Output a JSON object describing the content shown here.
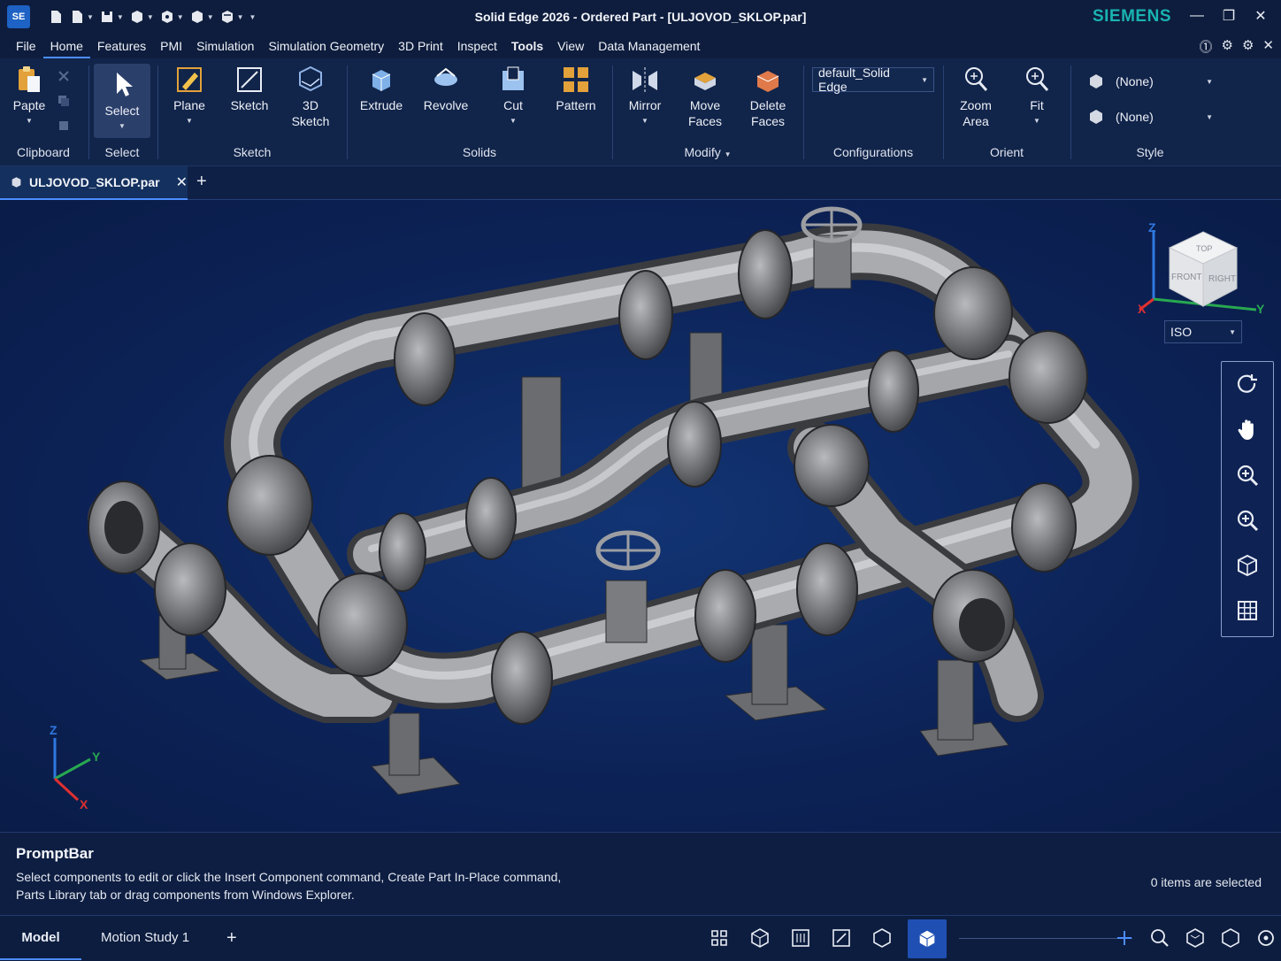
{
  "titlebar": {
    "app_badge": "SE",
    "title": "Solid Edge 2026 - Ordered Part - [ULJOVOD_SKLOP.par]",
    "brand": "SIEMENS"
  },
  "menu": {
    "tabs": [
      "File",
      "Home",
      "Features",
      "PMI",
      "Simulation",
      "Simulation Geometry",
      "3D Print",
      "Inspect",
      "Tools",
      "View",
      "Data Management"
    ],
    "active": "Home"
  },
  "ribbon": {
    "clipboard": {
      "paste": "Papte",
      "label": "Clipboard"
    },
    "select": {
      "button": "Select",
      "label": "Select"
    },
    "sketch": {
      "plane": "Plane",
      "sketch": "Sketch",
      "sketch3d_line1": "3D",
      "sketch3d_line2": "Sketch",
      "label": "Sketch"
    },
    "solids": {
      "extrude": "Extrude",
      "revolve": "Revolve",
      "cut": "Cut",
      "pattern": "Pattern",
      "label": "Solids"
    },
    "modify": {
      "mirror": "Mirror",
      "move_line1": "Move",
      "move_line2": "Faces",
      "delete_line1": "Delete",
      "delete_line2": "Faces",
      "label": "Modify"
    },
    "configurations": {
      "value": "default_Solid Edge",
      "label": "Configurations"
    },
    "orient": {
      "zoom_line1": "Zoom",
      "zoom_line2": "Area",
      "fit": "Fit",
      "label": "Orient"
    },
    "style": {
      "face_style": "(None)",
      "part_style": "(None)",
      "label": "Style"
    }
  },
  "document": {
    "tab": "ULJOVOD_SKLOP.par"
  },
  "viewport": {
    "view_orientation": "ISO",
    "viewcube_faces": {
      "top": "TOP",
      "front": "FRONT",
      "right": "RIGHT"
    },
    "axes": {
      "x": "X",
      "y": "Y",
      "z": "Z"
    }
  },
  "prompt": {
    "title": "PromptBar",
    "line1": "Select components to edit or click the Insert Component command, Create Part In-Place command,",
    "line2": "Parts Library tab or drag components from Windows Explorer.",
    "status": "0 items are selected"
  },
  "bottom": {
    "tabs": [
      "Model",
      "Motion Study 1"
    ],
    "active": "Model"
  },
  "colors": {
    "accent": "#4d8dff",
    "brand": "#19b3b1",
    "background": "#0d1f44"
  }
}
